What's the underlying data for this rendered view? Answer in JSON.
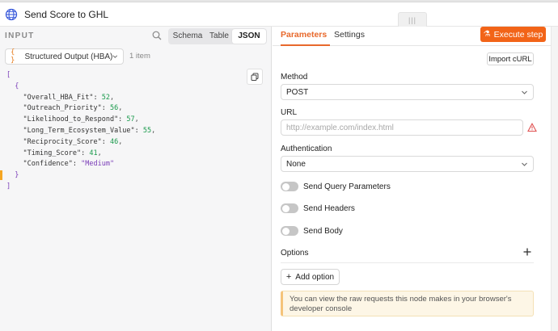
{
  "window": {
    "title": "Send Score to GHL",
    "globe_icon": "globe-icon",
    "grip_label": "|||"
  },
  "input_panel": {
    "label": "INPUT",
    "view_tabs": [
      "Schema",
      "Table",
      "JSON"
    ],
    "active_view": "JSON",
    "node_select": {
      "icon": "{ }",
      "value": "Structured Output (HBA)"
    },
    "item_count": "1 item",
    "json_lines": [
      {
        "indent": "",
        "parts": [
          {
            "t": "bracket",
            "v": "["
          }
        ]
      },
      {
        "indent": "  ",
        "parts": [
          {
            "t": "bracket",
            "v": "{"
          }
        ]
      },
      {
        "indent": "    ",
        "parts": [
          {
            "t": "jkey",
            "v": "\"Overall_HBA_Fit\":"
          },
          {
            "t": "jnum",
            "v": " 52"
          },
          {
            "t": "jpunct",
            "v": ","
          }
        ]
      },
      {
        "indent": "    ",
        "parts": [
          {
            "t": "jkey",
            "v": "\"Outreach_Priority\":"
          },
          {
            "t": "jnum",
            "v": " 56"
          },
          {
            "t": "jpunct",
            "v": ","
          }
        ]
      },
      {
        "indent": "    ",
        "parts": [
          {
            "t": "jkey",
            "v": "\"Likelihood_to_Respond\":"
          },
          {
            "t": "jnum",
            "v": " 57"
          },
          {
            "t": "jpunct",
            "v": ","
          }
        ]
      },
      {
        "indent": "    ",
        "parts": [
          {
            "t": "jkey",
            "v": "\"Long_Term_Ecosystem_Value\":"
          },
          {
            "t": "jnum",
            "v": " 55"
          },
          {
            "t": "jpunct",
            "v": ","
          }
        ]
      },
      {
        "indent": "    ",
        "parts": [
          {
            "t": "jkey",
            "v": "\"Reciprocity_Score\":"
          },
          {
            "t": "jnum",
            "v": " 46"
          },
          {
            "t": "jpunct",
            "v": ","
          }
        ]
      },
      {
        "indent": "    ",
        "parts": [
          {
            "t": "jkey",
            "v": "\"Timing_Score\":"
          },
          {
            "t": "jnum",
            "v": " 41"
          },
          {
            "t": "jpunct",
            "v": ","
          }
        ]
      },
      {
        "indent": "    ",
        "parts": [
          {
            "t": "jkey",
            "v": "\"Confidence\":"
          },
          {
            "t": "jstr",
            "v": " \"Medium\""
          }
        ]
      },
      {
        "indent": "  ",
        "parts": [
          {
            "t": "bracket",
            "v": "}"
          }
        ]
      },
      {
        "indent": "",
        "parts": [
          {
            "t": "bracket",
            "v": "]"
          }
        ]
      }
    ]
  },
  "params_panel": {
    "tabs": [
      "Parameters",
      "Settings"
    ],
    "active_tab": "Parameters",
    "execute_label": "Execute step",
    "import_curl_label": "Import cURL",
    "method": {
      "label": "Method",
      "value": "POST"
    },
    "url": {
      "label": "URL",
      "placeholder": "http://example.com/index.html"
    },
    "authentication": {
      "label": "Authentication",
      "value": "None"
    },
    "toggles": [
      {
        "label": "Send Query Parameters",
        "on": false
      },
      {
        "label": "Send Headers",
        "on": false
      },
      {
        "label": "Send Body",
        "on": false
      }
    ],
    "options_label": "Options",
    "add_option_label": "Add option",
    "notice": "You can view the raw requests this node makes in your browser's developer console"
  },
  "colors": {
    "accent": "#f26418",
    "json_number": "#1a9a4c",
    "json_string": "#7a3db8"
  }
}
